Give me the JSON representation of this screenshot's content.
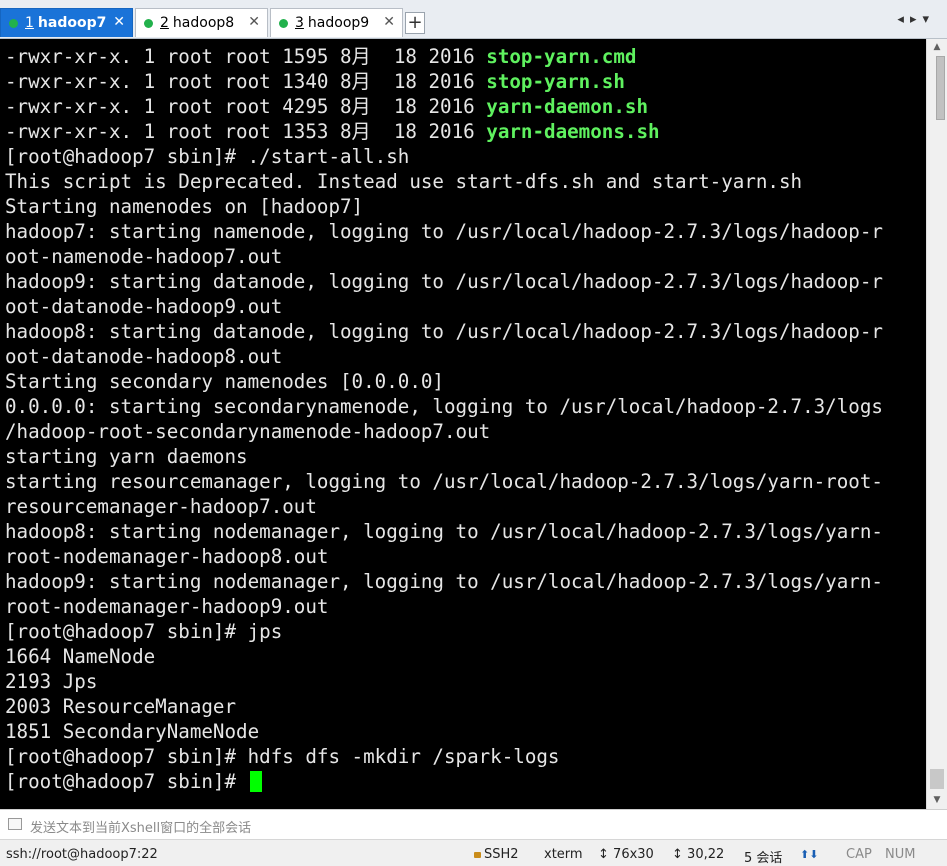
{
  "tabs": [
    {
      "num": "1",
      "name": "hadoop7",
      "close": "✕",
      "active": true
    },
    {
      "num": "2",
      "name": "hadoop8",
      "close": "✕",
      "active": false
    },
    {
      "num": "3",
      "name": "hadoop9",
      "close": "✕",
      "active": false
    }
  ],
  "new_tab_label": "+",
  "nav_arrows": "◂▸▾",
  "terminal": {
    "lines": [
      {
        "text": "-rwxr-xr-x. 1 root root 1595 8月  18 2016 ",
        "highlight": "stop-yarn.cmd"
      },
      {
        "text": "-rwxr-xr-x. 1 root root 1340 8月  18 2016 ",
        "highlight": "stop-yarn.sh"
      },
      {
        "text": "-rwxr-xr-x. 1 root root 4295 8月  18 2016 ",
        "highlight": "yarn-daemon.sh"
      },
      {
        "text": "-rwxr-xr-x. 1 root root 1353 8月  18 2016 ",
        "highlight": "yarn-daemons.sh"
      },
      {
        "text": "[root@hadoop7 sbin]# ./start-all.sh"
      },
      {
        "text": "This script is Deprecated. Instead use start-dfs.sh and start-yarn.sh"
      },
      {
        "text": "Starting namenodes on [hadoop7]"
      },
      {
        "text": "hadoop7: starting namenode, logging to /usr/local/hadoop-2.7.3/logs/hadoop-r"
      },
      {
        "text": "oot-namenode-hadoop7.out"
      },
      {
        "text": "hadoop9: starting datanode, logging to /usr/local/hadoop-2.7.3/logs/hadoop-r"
      },
      {
        "text": "oot-datanode-hadoop9.out"
      },
      {
        "text": "hadoop8: starting datanode, logging to /usr/local/hadoop-2.7.3/logs/hadoop-r"
      },
      {
        "text": "oot-datanode-hadoop8.out"
      },
      {
        "text": "Starting secondary namenodes [0.0.0.0]"
      },
      {
        "text": "0.0.0.0: starting secondarynamenode, logging to /usr/local/hadoop-2.7.3/logs"
      },
      {
        "text": "/hadoop-root-secondarynamenode-hadoop7.out"
      },
      {
        "text": "starting yarn daemons"
      },
      {
        "text": "starting resourcemanager, logging to /usr/local/hadoop-2.7.3/logs/yarn-root-"
      },
      {
        "text": "resourcemanager-hadoop7.out"
      },
      {
        "text": "hadoop8: starting nodemanager, logging to /usr/local/hadoop-2.7.3/logs/yarn-"
      },
      {
        "text": "root-nodemanager-hadoop8.out"
      },
      {
        "text": "hadoop9: starting nodemanager, logging to /usr/local/hadoop-2.7.3/logs/yarn-"
      },
      {
        "text": "root-nodemanager-hadoop9.out"
      },
      {
        "text": "[root@hadoop7 sbin]# jps"
      },
      {
        "text": "1664 NameNode"
      },
      {
        "text": "2193 Jps"
      },
      {
        "text": "2003 ResourceManager"
      },
      {
        "text": "1851 SecondaryNameNode"
      },
      {
        "text": "[root@hadoop7 sbin]# hdfs dfs -mkdir /spark-logs"
      },
      {
        "text": "[root@hadoop7 sbin]# ",
        "cursor": true
      }
    ]
  },
  "colors": {
    "terminal_bg": "#000000",
    "terminal_fg": "#e6e6e6",
    "highlight": "#5ff15f",
    "cursor": "#00ff00",
    "active_tab": "#1a73d8"
  },
  "compose_bar": {
    "placeholder": "发送文本到当前Xshell窗口的全部会话"
  },
  "status_bar": {
    "connection": "ssh://root@hadoop7:22",
    "protocol": "SSH2",
    "term": "xterm",
    "size": "76x30",
    "cursor_pos": "30,22",
    "sessions": "5 会话",
    "arrows": "⬆⬇",
    "caps": "CAP",
    "num": "NUM"
  }
}
